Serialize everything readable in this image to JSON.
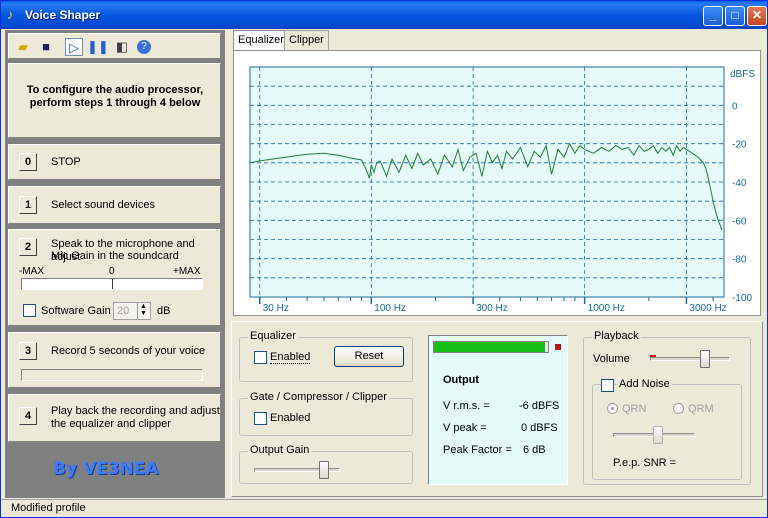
{
  "window": {
    "title": "Voice Shaper"
  },
  "colors": {
    "chart_bg": "#e8fbfb",
    "chart_line": "#1f7f2f",
    "grid": "#1a6aa0",
    "axis_text": "#1a6aa0",
    "meter_green": "#17c017"
  },
  "toolbar": {
    "icons": [
      "open-folder-icon",
      "save-disk-icon",
      "play-icon",
      "pause-icon",
      "speaker-icon",
      "help-icon"
    ]
  },
  "instructions": {
    "text": "To configure the audio processor, perform steps 1 through 4 below"
  },
  "steps": [
    {
      "num": "0",
      "label": "STOP"
    },
    {
      "num": "1",
      "label": "Select sound devices"
    },
    {
      "num": "2",
      "label_line1": "Speak to the microphone and adjust",
      "label_line2": "Mic Gain in the soundcard"
    },
    {
      "num": "3",
      "label": "Record 5 seconds of your voice"
    },
    {
      "num": "4",
      "label_line1": "Play back the recording and adjust",
      "label_line2": "the equalizer and clipper"
    }
  ],
  "mic_meter": {
    "left_label": "-MAX",
    "center_label": "0",
    "right_label": "+MAX"
  },
  "software_gain": {
    "label": "Software Gain",
    "value": "20",
    "unit": "dB",
    "checked": false
  },
  "credit": "By VE3NEA",
  "tabs": [
    {
      "label": "Equalizer",
      "active": true
    },
    {
      "label": "Clipper",
      "active": false
    }
  ],
  "chart_data": {
    "type": "line",
    "title": "",
    "xlabel": "",
    "ylabel": "dBFS",
    "xscale": "log",
    "xlim": [
      27,
      4500
    ],
    "ylim": [
      -100,
      20
    ],
    "x_ticks": [
      {
        "label": "30 Hz",
        "value": 30
      },
      {
        "label": "100 Hz",
        "value": 100
      },
      {
        "label": "300 Hz",
        "value": 300
      },
      {
        "label": "1000 Hz",
        "value": 1000
      },
      {
        "label": "3000 Hz",
        "value": 3000
      }
    ],
    "y_ticks": [
      0,
      -20,
      -40,
      -60,
      -80,
      -100
    ],
    "grid": true,
    "series": [
      {
        "x": [
          27,
          30,
          40,
          50,
          60,
          70,
          80,
          90,
          95,
          98,
          100,
          103,
          106,
          110,
          118,
          125,
          135,
          145,
          155,
          165,
          175,
          190,
          205,
          220,
          240,
          255,
          270,
          290,
          310,
          330,
          350,
          370,
          390,
          410,
          430,
          460,
          500,
          540,
          580,
          620,
          660,
          700,
          750,
          800,
          850,
          900,
          950,
          1000,
          1100,
          1200,
          1300,
          1400,
          1500,
          1600,
          1700,
          1800,
          1900,
          2000,
          2100,
          2200,
          2300,
          2400,
          2500,
          2600,
          2700,
          2800,
          2900,
          3000,
          3200,
          3400,
          3600,
          3700,
          3800,
          3900,
          4000,
          4100,
          4200,
          4300,
          4400
        ],
        "values": [
          -30,
          -29,
          -27,
          -25.5,
          -25,
          -26,
          -27.5,
          -28.5,
          -34,
          -38,
          -31,
          -35,
          -30,
          -29,
          -37,
          -28,
          -35,
          -26,
          -33,
          -25,
          -31,
          -28,
          -36,
          -26,
          -32,
          -23,
          -34,
          -27,
          -25,
          -37,
          -24,
          -30,
          -26,
          -33,
          -24,
          -28,
          -22,
          -32,
          -24,
          -27,
          -21,
          -36,
          -23,
          -27,
          -20,
          -25,
          -21,
          -23,
          -25,
          -22,
          -24,
          -21,
          -23,
          -22,
          -26,
          -21,
          -24,
          -23,
          -21,
          -25,
          -22,
          -24,
          -22,
          -26,
          -21,
          -24,
          -22,
          -23,
          -25,
          -27,
          -30,
          -33,
          -38,
          -44,
          -50,
          -55,
          -59,
          -62,
          -65
        ]
      }
    ]
  },
  "equalizer_group": {
    "title": "Equalizer",
    "enabled_label": "Enabled",
    "reset_label": "Reset"
  },
  "gate_group": {
    "title": "Gate / Compressor / Clipper",
    "enabled_label": "Enabled"
  },
  "output_gain": {
    "title": "Output Gain",
    "level": 0.85
  },
  "output": {
    "level_fraction": 0.97,
    "title": "Output",
    "vrms_label": "V r.m.s. =",
    "vrms_value": "-6 dBFS",
    "vpeak_label": "V peak =",
    "vpeak_value": "0 dBFS",
    "peak_label": "Peak Factor =",
    "peak_value": "6 dB"
  },
  "playback": {
    "title": "Playback",
    "volume_label": "Volume",
    "volume_level": 0.72,
    "add_noise_label": "Add Noise",
    "qrn_label": "QRN",
    "qrm_label": "QRM",
    "noise_level": 0.55,
    "snr_label": "P.e.p. SNR ="
  },
  "statusbar": {
    "text": "Modified profile"
  }
}
